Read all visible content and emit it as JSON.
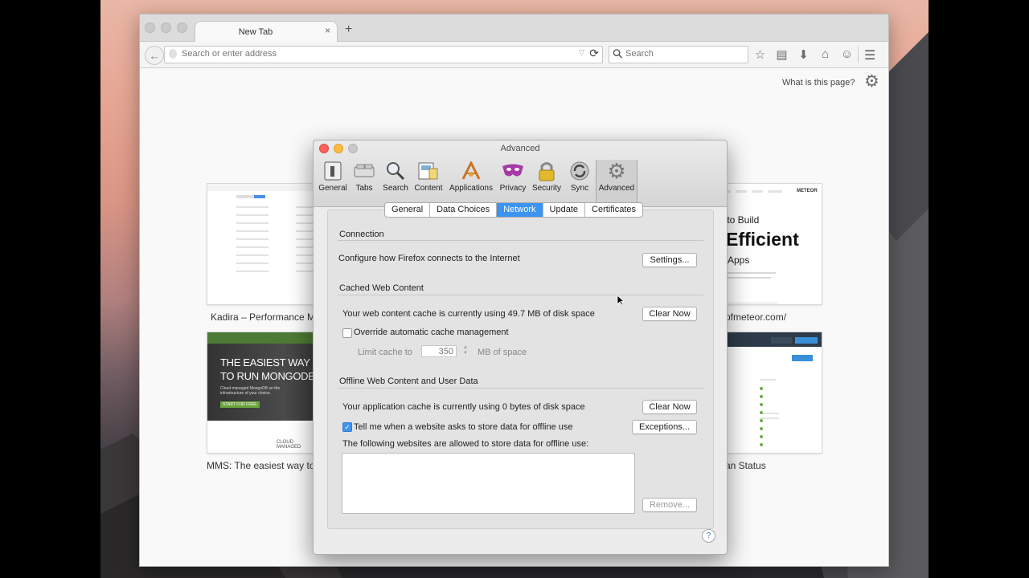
{
  "browser": {
    "tab_title": "New Tab",
    "tab_close": "×",
    "new_tab": "+",
    "back": "←",
    "url_placeholder": "Search or enter address",
    "url_value": "",
    "reload": "⟳",
    "search_placeholder": "Search",
    "menu": "☰"
  },
  "newtab_page": {
    "what_is": "What is this page?",
    "tiles": [
      {
        "label": "Kadira – Performance Mo"
      },
      {
        "label": "ofmeteor.com/"
      },
      {
        "label": "MMS: The easiest way to"
      },
      {
        "label": "an Status"
      }
    ],
    "tile_texts": {
      "mongo_heading1": "THE EASIEST WAY",
      "mongo_heading2": "TO RUN MONGODB",
      "mongo_sub": "Cloud managed MongoDB on the infrastructure of your choice.",
      "mongo_btn": "START FOR FREE",
      "mongo_footer": "CLOUD MANAGED",
      "meteor_line1": "y to Build",
      "meteor_line2": "Efficient",
      "meteor_line3": "Apps",
      "meteor_logo": "METEOR"
    }
  },
  "dialog": {
    "title": "Advanced",
    "toolbar": [
      {
        "label": "General",
        "icon": "general-icon"
      },
      {
        "label": "Tabs",
        "icon": "tabs-icon"
      },
      {
        "label": "Search",
        "icon": "search-icon"
      },
      {
        "label": "Content",
        "icon": "content-icon"
      },
      {
        "label": "Applications",
        "icon": "applications-icon"
      },
      {
        "label": "Privacy",
        "icon": "privacy-icon"
      },
      {
        "label": "Security",
        "icon": "security-icon"
      },
      {
        "label": "Sync",
        "icon": "sync-icon"
      },
      {
        "label": "Advanced",
        "icon": "advanced-icon"
      }
    ],
    "segments": [
      "General",
      "Data Choices",
      "Network",
      "Update",
      "Certificates"
    ],
    "selected_segment": "Network",
    "connection": {
      "heading": "Connection",
      "text": "Configure how Firefox connects to the Internet",
      "settings_btn": "Settings..."
    },
    "cache": {
      "heading": "Cached Web Content",
      "status": "Your web content cache is currently using 49.7 MB of disk space",
      "clear_btn": "Clear Now",
      "override_label": "Override automatic cache management",
      "override_checked": false,
      "limit_label": "Limit cache to",
      "limit_value": "350",
      "limit_unit": "MB of space"
    },
    "offline": {
      "heading": "Offline Web Content and User Data",
      "status": "Your application cache is currently using 0 bytes of disk space",
      "clear_btn": "Clear Now",
      "tell_label": "Tell me when a website asks to store data for offline use",
      "tell_checked": true,
      "exceptions_btn": "Exceptions...",
      "allowed_label": "The following websites are allowed to store data for offline use:",
      "remove_btn": "Remove..."
    },
    "help": "?"
  },
  "colors": {
    "accent": "#3d93f2",
    "close_light": "#fc605b",
    "minimize_light": "#fdbc40",
    "zoom_light": "#c8c8c8"
  }
}
